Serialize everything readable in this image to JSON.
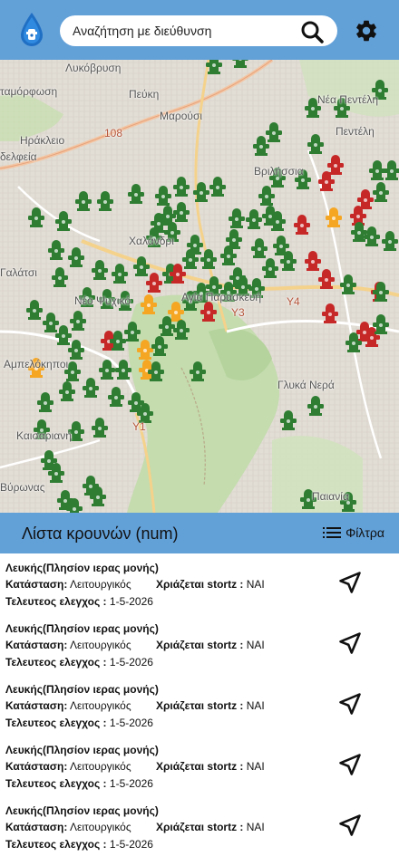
{
  "header": {
    "search_placeholder": "Αναζήτηση με διεύθυνση"
  },
  "map": {
    "labels": {
      "l1": "Λυκόβρυση",
      "l2": "ταμόρφωση",
      "l3": "Πεύκη",
      "l4": "Νέα Πεντέλη",
      "l5": "Μαρούσι",
      "l6": "Πεντέλη",
      "l7": "Ηράκλειο",
      "l8": "δελφεία",
      "l9": "Βριλήσσια",
      "l10": "Χαλάνδρι",
      "l11": "Γαλάτσι",
      "l12": "Νέο Ψυχικό",
      "l13": "Αγία Παρασκευή",
      "l14": "Αμπελόκηποι",
      "l15": "Γλυκά Νερά",
      "l16": "Καισαριανή",
      "l17": "Βύρωνας",
      "l18": "Παιανία",
      "l19": "108",
      "l20": "Υ4",
      "l21": "Υ3",
      "l22": "Υ1"
    }
  },
  "list": {
    "title": "Λίστα κρουνών (num)",
    "filters_label": "Φίλτρα",
    "items": [
      {
        "name": "Λευκής(Πλησίον ιερας μονής)",
        "status_label": "Κατάσταση:",
        "status": "Λειτουργικός",
        "stortz_label": "Χριάζεται stortz :",
        "stortz": "ΝΑΙ",
        "check_label": "Τελευτεος ελεγχος :",
        "check": "1-5-2026"
      },
      {
        "name": "Λευκής(Πλησίον ιερας μονής)",
        "status_label": "Κατάσταση:",
        "status": "Λειτουργικός",
        "stortz_label": "Χριάζεται stortz :",
        "stortz": "ΝΑΙ",
        "check_label": "Τελευτεος ελεγχος :",
        "check": "1-5-2026"
      },
      {
        "name": "Λευκής(Πλησίον ιερας μονής)",
        "status_label": "Κατάσταση:",
        "status": "Λειτουργικός",
        "stortz_label": "Χριάζεται stortz :",
        "stortz": "ΝΑΙ",
        "check_label": "Τελευτεος ελεγχος :",
        "check": "1-5-2026"
      },
      {
        "name": "Λευκής(Πλησίον ιερας μονής)",
        "status_label": "Κατάσταση:",
        "status": "Λειτουργικός",
        "stortz_label": "Χριάζεται stortz :",
        "stortz": "ΝΑΙ",
        "check_label": "Τελευτεος ελεγχος :",
        "check": "1-5-2026"
      },
      {
        "name": "Λευκής(Πλησίον ιερας μονής)",
        "status_label": "Κατάσταση:",
        "status": "Λειτουργικός",
        "stortz_label": "Χριάζεται stortz :",
        "stortz": "ΝΑΙ",
        "check_label": "Τελευτεος ελεγχος :",
        "check": "1-5-2026"
      }
    ]
  },
  "colors": {
    "header_bg": "#62a0d8",
    "marker_ok": "#2e7d32",
    "marker_warning": "#f5a623",
    "marker_broken": "#c62828"
  }
}
